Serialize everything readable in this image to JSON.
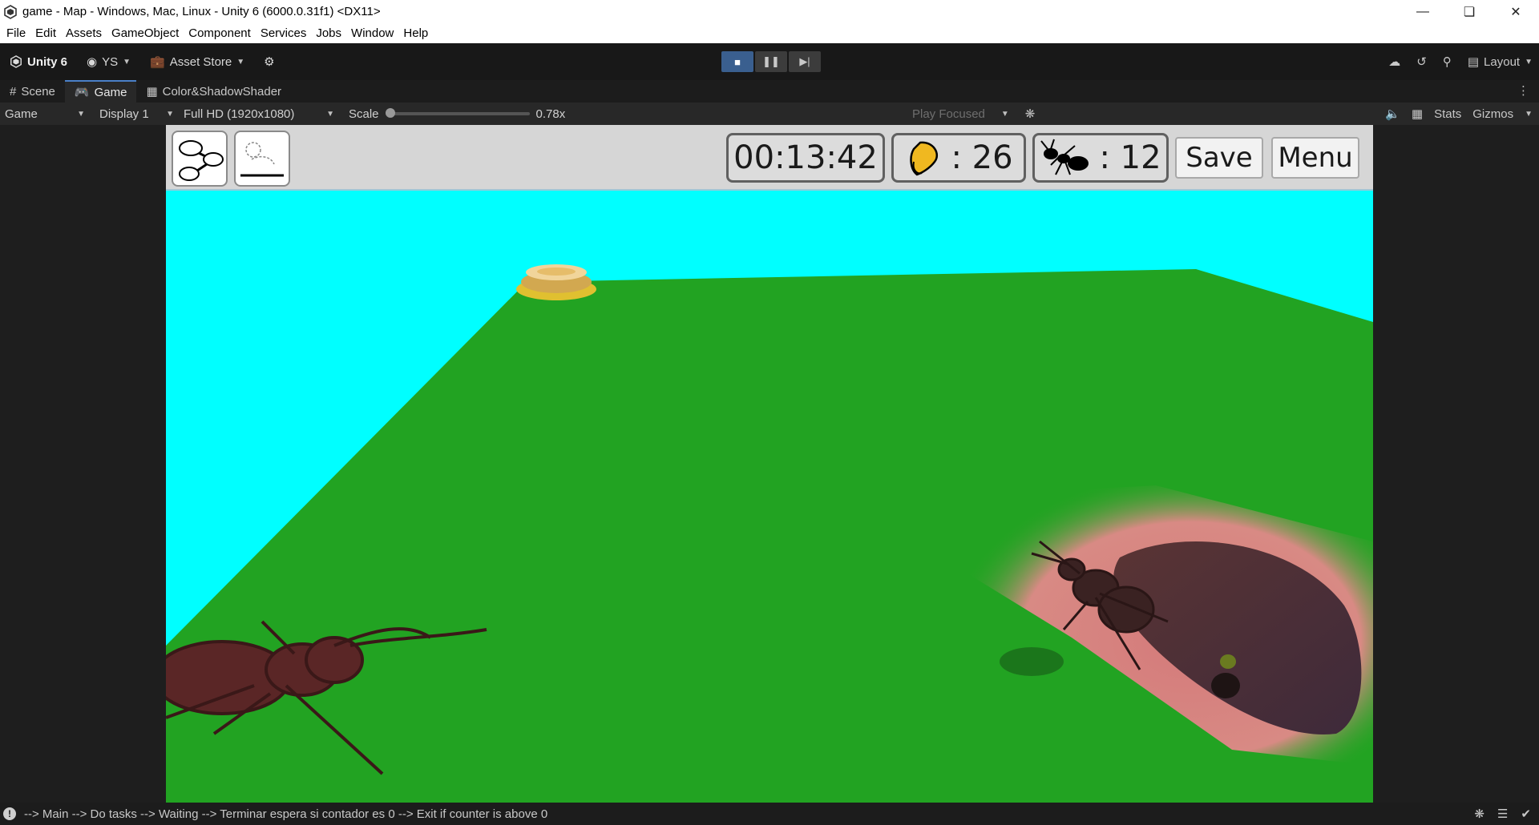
{
  "window": {
    "title": "game - Map - Windows, Mac, Linux - Unity 6 (6000.0.31f1) <DX11>"
  },
  "menu": [
    "File",
    "Edit",
    "Assets",
    "GameObject",
    "Component",
    "Services",
    "Jobs",
    "Window",
    "Help"
  ],
  "toolbar": {
    "unity_label": "Unity 6",
    "account_label": "YS",
    "asset_store_label": "Asset Store",
    "layout_label": "Layout"
  },
  "tabs": [
    {
      "label": "Scene"
    },
    {
      "label": "Game"
    },
    {
      "label": "Color&ShadowShader"
    }
  ],
  "gamebar": {
    "view_mode": "Game",
    "display": "Display 1",
    "resolution": "Full HD (1920x1080)",
    "scale_label": "Scale",
    "scale_value": "0.78x",
    "play_mode": "Play Focused",
    "stats_label": "Stats",
    "gizmos_label": "Gizmos"
  },
  "hud": {
    "timer": "00:13:42",
    "seeds_count": ": 26",
    "ants_count": ": 12",
    "save_label": "Save",
    "menu_label": "Menu"
  },
  "status": {
    "message": "--> Main --> Do tasks --> Waiting --> Terminar espera si contador es 0 --> Exit if counter is above 0"
  },
  "colors": {
    "sky": "#00ffff",
    "ground": "#22a322",
    "nest": "#d47a7a",
    "ant": "#4a2424",
    "accent": "#3a5f8f"
  }
}
